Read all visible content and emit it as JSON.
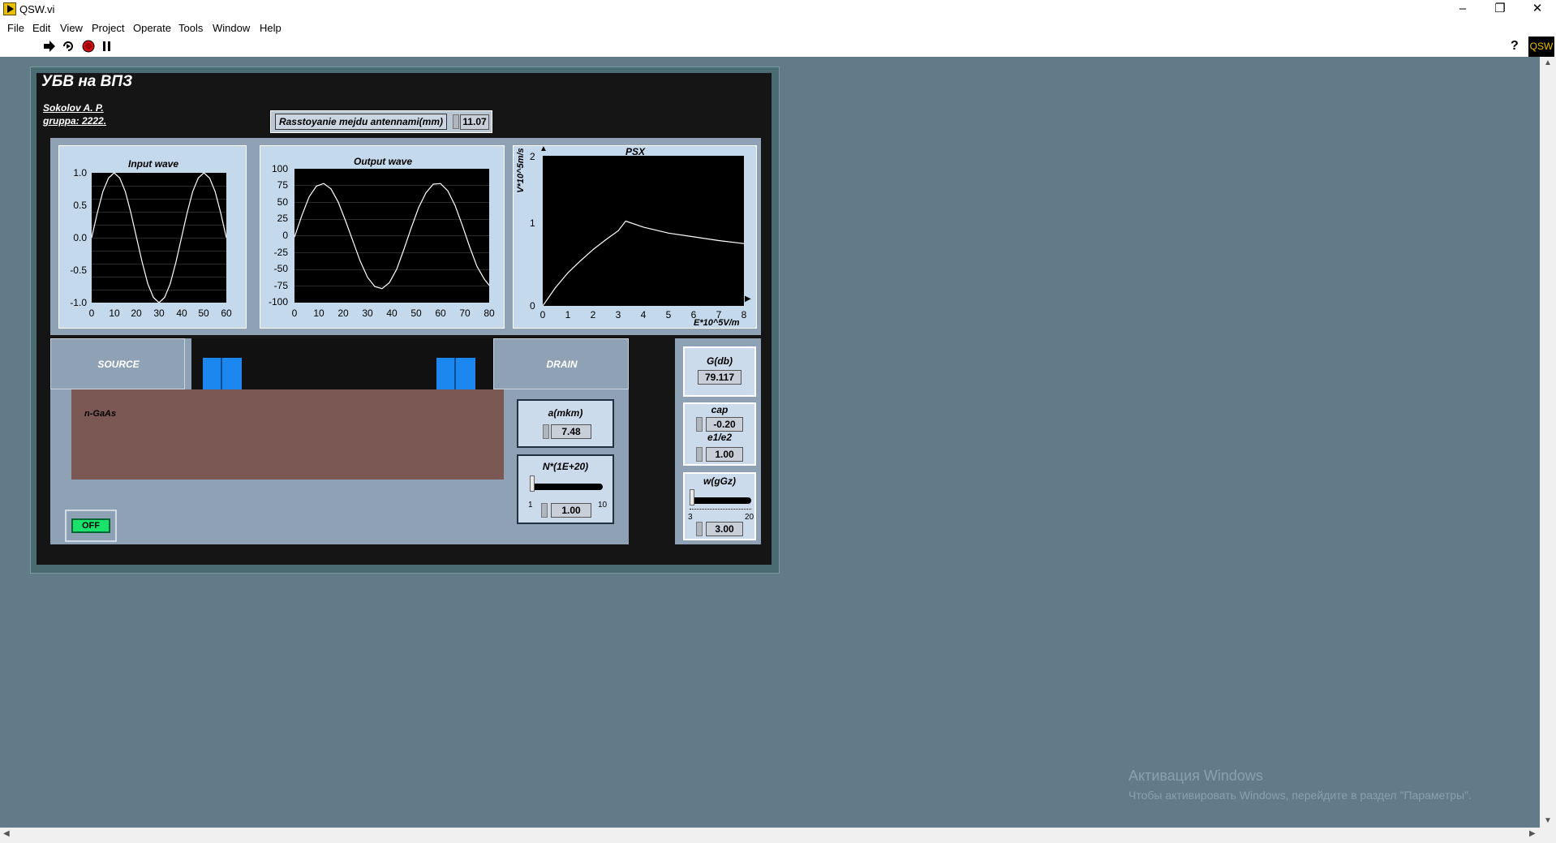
{
  "window": {
    "title": "QSW.vi",
    "controls": {
      "minimize": "–",
      "restore": "❐",
      "close": "✕"
    }
  },
  "menu": [
    "File",
    "Edit",
    "View",
    "Project",
    "Operate",
    "Tools",
    "Window",
    "Help"
  ],
  "toolbar": {
    "icons": [
      "run-arrow-icon",
      "run-continuous-icon",
      "abort-icon",
      "pause-icon"
    ],
    "help": "?",
    "badge": "QSW"
  },
  "vi": {
    "title": "УБВ на ВПЗ",
    "author_line1": "Sokolov A. P.",
    "author_line2": "gruppa: 2222.",
    "distance": {
      "label": "Rasstoyanie mejdu antennami(mm)",
      "value": "11.07"
    }
  },
  "charts": {
    "input": {
      "title": "Input wave",
      "y_ticks": [
        "1.0",
        "0.5",
        "0.0",
        "-0.5",
        "-1.0"
      ],
      "x_ticks": [
        "0",
        "10",
        "20",
        "30",
        "40",
        "50",
        "60"
      ]
    },
    "output": {
      "title": "Output wave",
      "y_ticks": [
        "100",
        "75",
        "50",
        "25",
        "0",
        "-25",
        "-50",
        "-75",
        "-100"
      ],
      "x_ticks": [
        "0",
        "10",
        "20",
        "30",
        "40",
        "50",
        "60",
        "70",
        "80"
      ]
    },
    "psx": {
      "title": "PSX",
      "ylabel": "V*10^5m/s",
      "xlabel": "E*10^5V/m",
      "y_ticks": [
        "2",
        "1",
        "0"
      ],
      "x_ticks": [
        "0",
        "1",
        "2",
        "3",
        "4",
        "5",
        "6",
        "7",
        "8"
      ]
    }
  },
  "chart_data": [
    {
      "type": "line",
      "title": "Input wave",
      "xlim": [
        0,
        60
      ],
      "ylim": [
        -1,
        1
      ],
      "series": [
        {
          "x": [
            0,
            2.5,
            5,
            7.5,
            10,
            12.5,
            15,
            17.5,
            20,
            22.5,
            25,
            27.5,
            30,
            32.5,
            35,
            37.5,
            40,
            42.5,
            45,
            47.5,
            50,
            52.5,
            55,
            57.5,
            60
          ],
          "y": [
            0,
            0.38,
            0.71,
            0.92,
            1.0,
            0.92,
            0.71,
            0.38,
            0,
            -0.38,
            -0.71,
            -0.92,
            -1.0,
            -0.92,
            -0.71,
            -0.38,
            0,
            0.38,
            0.71,
            0.92,
            1.0,
            0.92,
            0.71,
            0.38,
            0
          ]
        }
      ]
    },
    {
      "type": "line",
      "title": "Output wave",
      "xlim": [
        0,
        80
      ],
      "ylim": [
        -100,
        100
      ],
      "series": [
        {
          "x": [
            0,
            3,
            6,
            9,
            12,
            15,
            18,
            21,
            24,
            27,
            30,
            33,
            36,
            39,
            42,
            45,
            48,
            51,
            54,
            57,
            60,
            63,
            66,
            69,
            72,
            75,
            78,
            80
          ],
          "y": [
            -2,
            30,
            58,
            74,
            78,
            70,
            50,
            22,
            -8,
            -38,
            -62,
            -76,
            -79,
            -70,
            -50,
            -20,
            12,
            42,
            64,
            77,
            78,
            67,
            45,
            15,
            -17,
            -46,
            -65,
            -74
          ]
        }
      ]
    },
    {
      "type": "line",
      "title": "PSX",
      "xlabel": "E*10^5V/m",
      "ylabel": "V*10^5m/s",
      "xlim": [
        0,
        8
      ],
      "ylim": [
        0,
        2
      ],
      "series": [
        {
          "x": [
            0,
            0.5,
            1,
            1.5,
            2,
            2.5,
            3,
            3.3,
            4,
            5,
            6,
            7,
            8
          ],
          "y": [
            0,
            0.24,
            0.44,
            0.6,
            0.75,
            0.88,
            1.0,
            1.13,
            1.05,
            0.97,
            0.92,
            0.87,
            0.83
          ]
        }
      ]
    }
  ],
  "device": {
    "source": "SOURCE",
    "drain": "DRAIN",
    "substrate": "n-GaAs",
    "switch": "OFF"
  },
  "params": {
    "a": {
      "label": "a(mkm)",
      "value": "7.48"
    },
    "n": {
      "label": "N*(1E+20)",
      "value": "1.00",
      "min": "1",
      "max": "10",
      "level": 0
    },
    "g": {
      "label": "G(db)",
      "value": "79.117"
    },
    "cap": {
      "label": "cap",
      "value": "-0.20"
    },
    "e1e2": {
      "label": "e1/e2",
      "value": "1.00"
    },
    "w": {
      "label": "w(gGz)",
      "value": "3.00",
      "min": "3",
      "max": "20",
      "level": 0
    }
  },
  "watermark": {
    "line1": "Активация Windows",
    "line2": "Чтобы активировать Windows, перейдите в раздел \"Параметры\"."
  },
  "colors": {
    "canvas": "#627b89",
    "vi_bg": "#151515",
    "panel": "#8fa1b5",
    "plot_bg": "#000000",
    "electrode": "#1d87f0",
    "substrate": "#7b5853",
    "switch_on": "#19e36a"
  }
}
